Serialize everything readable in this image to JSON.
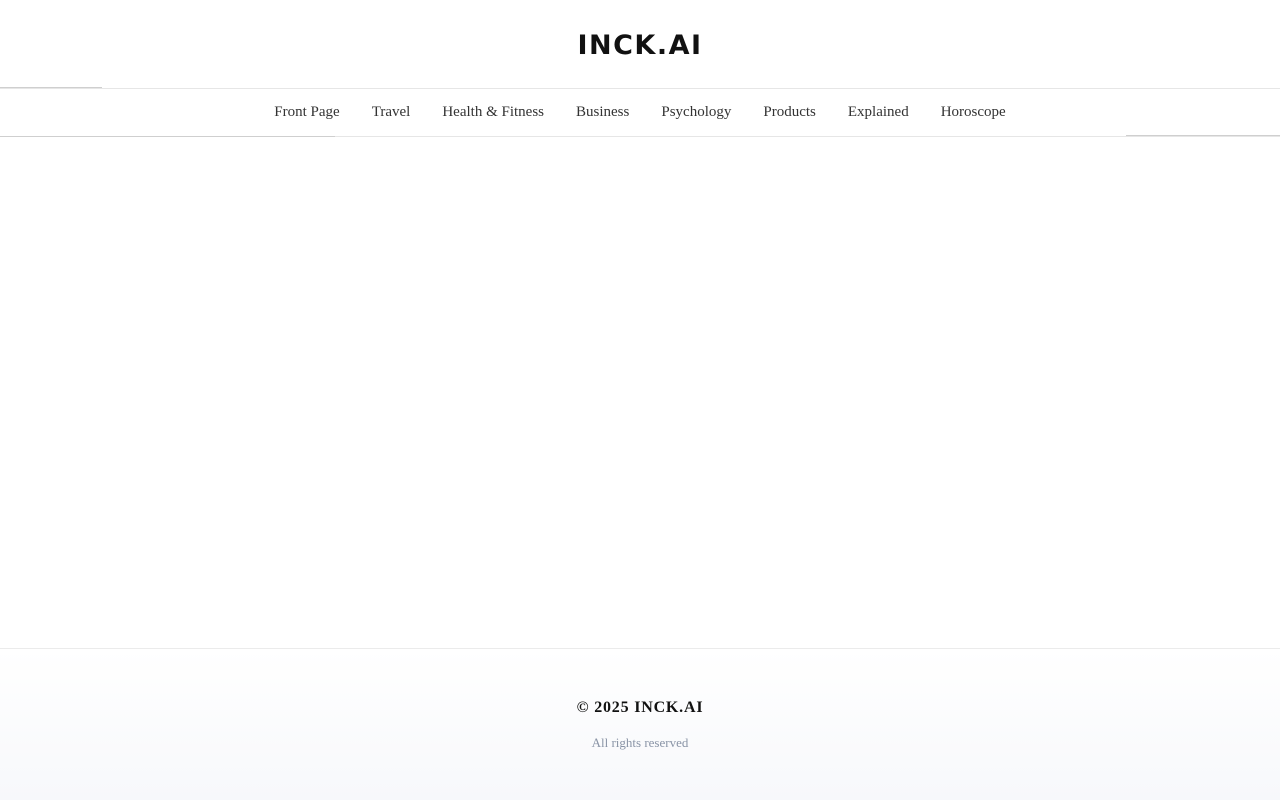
{
  "header": {
    "logo_text": "INCK.AI"
  },
  "nav": {
    "items": [
      {
        "label": "Front Page"
      },
      {
        "label": "Travel"
      },
      {
        "label": "Health & Fitness"
      },
      {
        "label": "Business"
      },
      {
        "label": "Psychology"
      },
      {
        "label": "Products"
      },
      {
        "label": "Explained"
      },
      {
        "label": "Horoscope"
      }
    ]
  },
  "footer": {
    "copyright": "© 2025 INCK.AI",
    "rights": "All rights reserved"
  },
  "colors": {
    "text": "#222222",
    "logo": "#111111",
    "muted": "#8a94a6",
    "border": "#e6e6e6",
    "footer_bg": "#f7f8fb"
  }
}
